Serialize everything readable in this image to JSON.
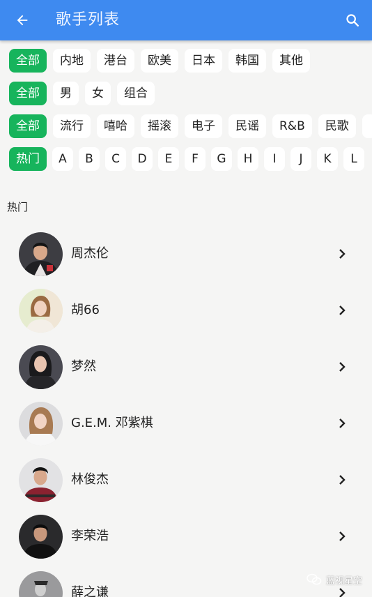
{
  "header": {
    "title": "歌手列表",
    "back_icon": "arrow-left-icon",
    "search_icon": "search-icon",
    "bar_color": "#3e8af0"
  },
  "filters": {
    "active_color": "#17b45c",
    "region": {
      "selected": "全部",
      "options": [
        "全部",
        "内地",
        "港台",
        "欧美",
        "日本",
        "韩国",
        "其他"
      ]
    },
    "gender": {
      "selected": "全部",
      "options": [
        "全部",
        "男",
        "女",
        "组合"
      ]
    },
    "genre": {
      "selected": "全部",
      "options": [
        "全部",
        "流行",
        "嘻哈",
        "摇滚",
        "电子",
        "民谣",
        "R&B",
        "民歌"
      ]
    },
    "index": {
      "selected": "热门",
      "options": [
        "热门",
        "A",
        "B",
        "C",
        "D",
        "E",
        "F",
        "G",
        "H",
        "I",
        "J",
        "K",
        "L"
      ]
    }
  },
  "section": {
    "title": "热门"
  },
  "singers": [
    {
      "name": "周杰伦"
    },
    {
      "name": "胡66"
    },
    {
      "name": "梦然"
    },
    {
      "name": "G.E.M. 邓紫棋"
    },
    {
      "name": "林俊杰"
    },
    {
      "name": "李荣浩"
    },
    {
      "name": "薛之谦"
    }
  ],
  "watermark": {
    "text": "蓝视星空"
  }
}
